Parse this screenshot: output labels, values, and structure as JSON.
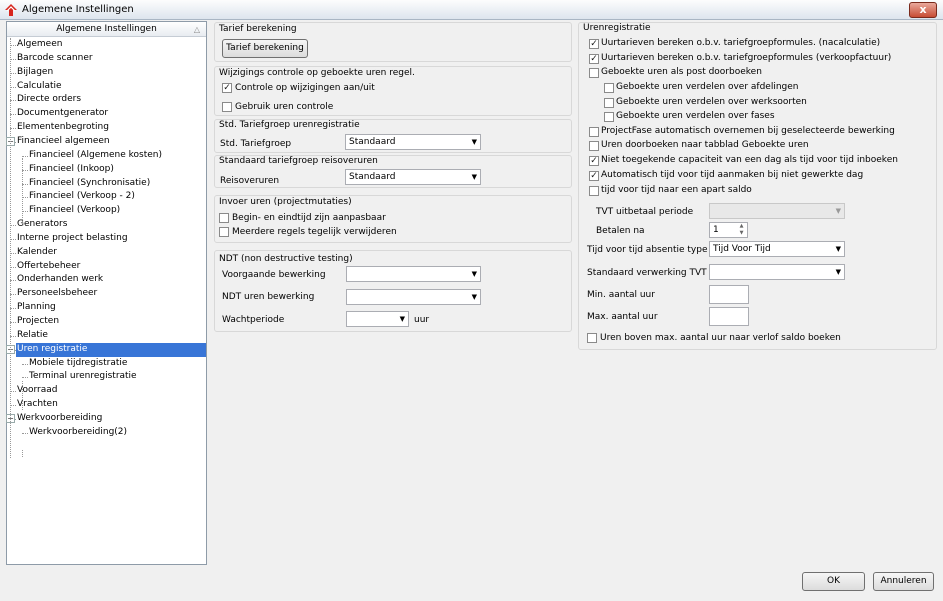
{
  "window": {
    "title": "Algemene Instellingen",
    "close_label": "x"
  },
  "tree": {
    "header": "Algemene Instellingen",
    "items": [
      {
        "label": "Algemeen"
      },
      {
        "label": "Barcode scanner"
      },
      {
        "label": "Bijlagen"
      },
      {
        "label": "Calculatie"
      },
      {
        "label": "Directe orders"
      },
      {
        "label": "Documentgenerator"
      },
      {
        "label": "Elementenbegroting"
      },
      {
        "label": "Financieel algemeen"
      },
      {
        "label": "Financieel (Algemene kosten)"
      },
      {
        "label": "Financieel (Inkoop)"
      },
      {
        "label": "Financieel (Synchronisatie)"
      },
      {
        "label": "Financieel (Verkoop - 2)"
      },
      {
        "label": "Financieel (Verkoop)"
      },
      {
        "label": "Generators"
      },
      {
        "label": "Interne project belasting"
      },
      {
        "label": "Kalender"
      },
      {
        "label": "Offertebeheer"
      },
      {
        "label": "Onderhanden werk"
      },
      {
        "label": "Personeelsbeheer"
      },
      {
        "label": "Planning"
      },
      {
        "label": "Projecten"
      },
      {
        "label": "Relatie"
      },
      {
        "label": "Uren registratie"
      },
      {
        "label": "Mobiele tijdregistratie"
      },
      {
        "label": "Terminal urenregistratie"
      },
      {
        "label": "Voorraad"
      },
      {
        "label": "Vrachten"
      },
      {
        "label": "Werkvoorbereiding"
      },
      {
        "label": "Werkvoorbereiding(2)"
      }
    ],
    "expander_symbol": "−"
  },
  "tarief": {
    "title": "Tarief berekening",
    "button": "Tarief berekening"
  },
  "wijzigings": {
    "title": "Wijzigings controle op geboekte uren regel.",
    "controle": {
      "label": "Controle op wijzigingen aan/uit",
      "checked": true
    },
    "gebruik": {
      "label": "Gebruik uren controle",
      "checked": false
    }
  },
  "std_tariefgroep": {
    "title": "Std. Tariefgroep urenregistratie",
    "field_label": "Std. Tariefgroep",
    "value": "Standaard"
  },
  "reisoveruren": {
    "title": "Standaard tariefgroep reisoveruren",
    "field_label": "Reisoveruren",
    "value": "Standaard"
  },
  "invoer": {
    "title": "Invoer uren (projectmutaties)",
    "begin_eind": {
      "label": "Begin- en eindtijd zijn aanpasbaar",
      "checked": false
    },
    "meerdere": {
      "label": "Meerdere regels tegelijk verwijderen",
      "checked": false
    }
  },
  "ndt": {
    "title": "NDT (non destructive testing)",
    "voorgaande_label": "Voorgaande bewerking",
    "voorgaande_value": "",
    "uren_label": "NDT uren bewerking",
    "uren_value": "",
    "wacht_label": "Wachtperiode",
    "wacht_value": "",
    "wacht_unit": "uur"
  },
  "urenregistratie": {
    "title": "Urenregistratie",
    "checkboxes": [
      {
        "label": "Uurtarieven bereken o.b.v. tariefgroepformules. (nacalculatie)",
        "checked": true
      },
      {
        "label": "Uurtarieven bereken o.b.v. tariefgroepformules (verkoopfactuur)",
        "checked": true
      },
      {
        "label": "Geboekte uren als post doorboeken",
        "checked": false
      },
      {
        "label": "Geboekte uren verdelen over afdelingen",
        "checked": false
      },
      {
        "label": "Geboekte uren verdelen over werksoorten",
        "checked": false
      },
      {
        "label": "Geboekte uren verdelen over fases",
        "checked": false
      },
      {
        "label": "ProjectFase automatisch overnemen bij geselecteerde bewerking",
        "checked": false
      },
      {
        "label": "Uren doorboeken naar tabblad Geboekte uren",
        "checked": false
      },
      {
        "label": "Niet toegekende capaciteit van een dag als tijd voor tijd inboeken",
        "checked": true
      },
      {
        "label": "Automatisch tijd voor tijd aanmaken bij niet gewerkte dag",
        "checked": true
      },
      {
        "label": "tijd voor tijd naar een apart saldo",
        "checked": false
      }
    ],
    "tvt_label": "TVT uitbetaal periode",
    "tvt_value": "",
    "betalen_label": "Betalen na",
    "betalen_value": "1",
    "absentie_label": "Tijd voor tijd absentie type",
    "absentie_value": "Tijd Voor Tijd",
    "verwerking_label": "Standaard verwerking TVT",
    "verwerking_value": "",
    "min_label": "Min. aantal uur",
    "min_value": "",
    "max_label": "Max. aantal uur",
    "max_value": "",
    "boven_max": {
      "label": "Uren boven max. aantal uur naar verlof saldo boeken",
      "checked": false
    }
  },
  "footer": {
    "ok": "OK",
    "cancel": "Annuleren"
  },
  "glyphs": {
    "check": "✓",
    "dropdown": "▼",
    "sort": "△",
    "spin_up": "▲",
    "spin_down": "▼"
  }
}
